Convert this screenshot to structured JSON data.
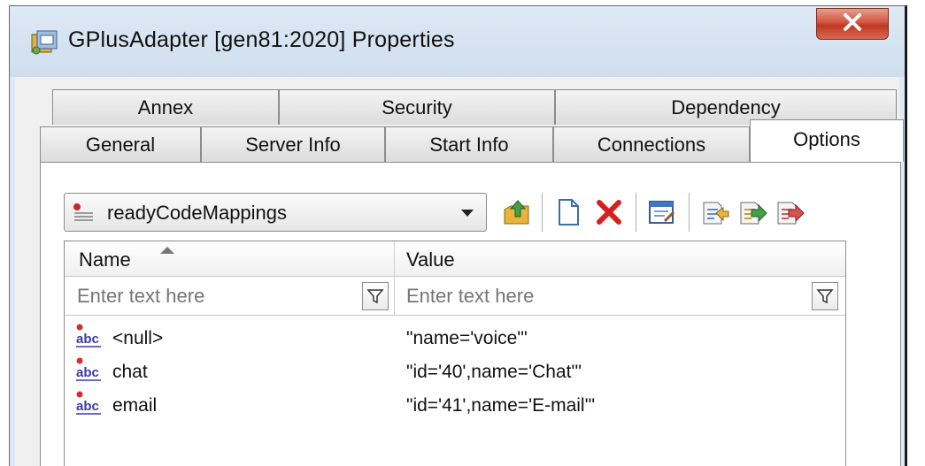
{
  "window": {
    "title": "GPlusAdapter [gen81:2020] Properties"
  },
  "tabs": {
    "row1": [
      {
        "label": "Annex"
      },
      {
        "label": "Security"
      },
      {
        "label": "Dependency"
      }
    ],
    "row2": [
      {
        "label": "General"
      },
      {
        "label": "Server Info"
      },
      {
        "label": "Start Info"
      },
      {
        "label": "Connections"
      },
      {
        "label": "Options",
        "active": true
      }
    ]
  },
  "section_selector": {
    "selected": "readyCodeMappings"
  },
  "toolbar": {
    "icons": [
      "up-folder-icon",
      "new-document-icon",
      "delete-icon",
      "edit-icon",
      "import-icon",
      "export-icon",
      "copy-icon"
    ]
  },
  "grid": {
    "columns": [
      {
        "label": "Name",
        "sort": "ascending"
      },
      {
        "label": "Value"
      }
    ],
    "filters": {
      "name_placeholder": "Enter text here",
      "value_placeholder": "Enter text here"
    },
    "rows": [
      {
        "name": "<null>",
        "value": "\"name='voice'\""
      },
      {
        "name": "chat",
        "value": "\"id='40',name='Chat'\""
      },
      {
        "name": "email",
        "value": "\"id='41',name='E-mail'\""
      }
    ]
  },
  "colors": {
    "title_bg": "#dde8f4",
    "close_button": "#c8432a",
    "delete_icon": "#d61f1f"
  }
}
